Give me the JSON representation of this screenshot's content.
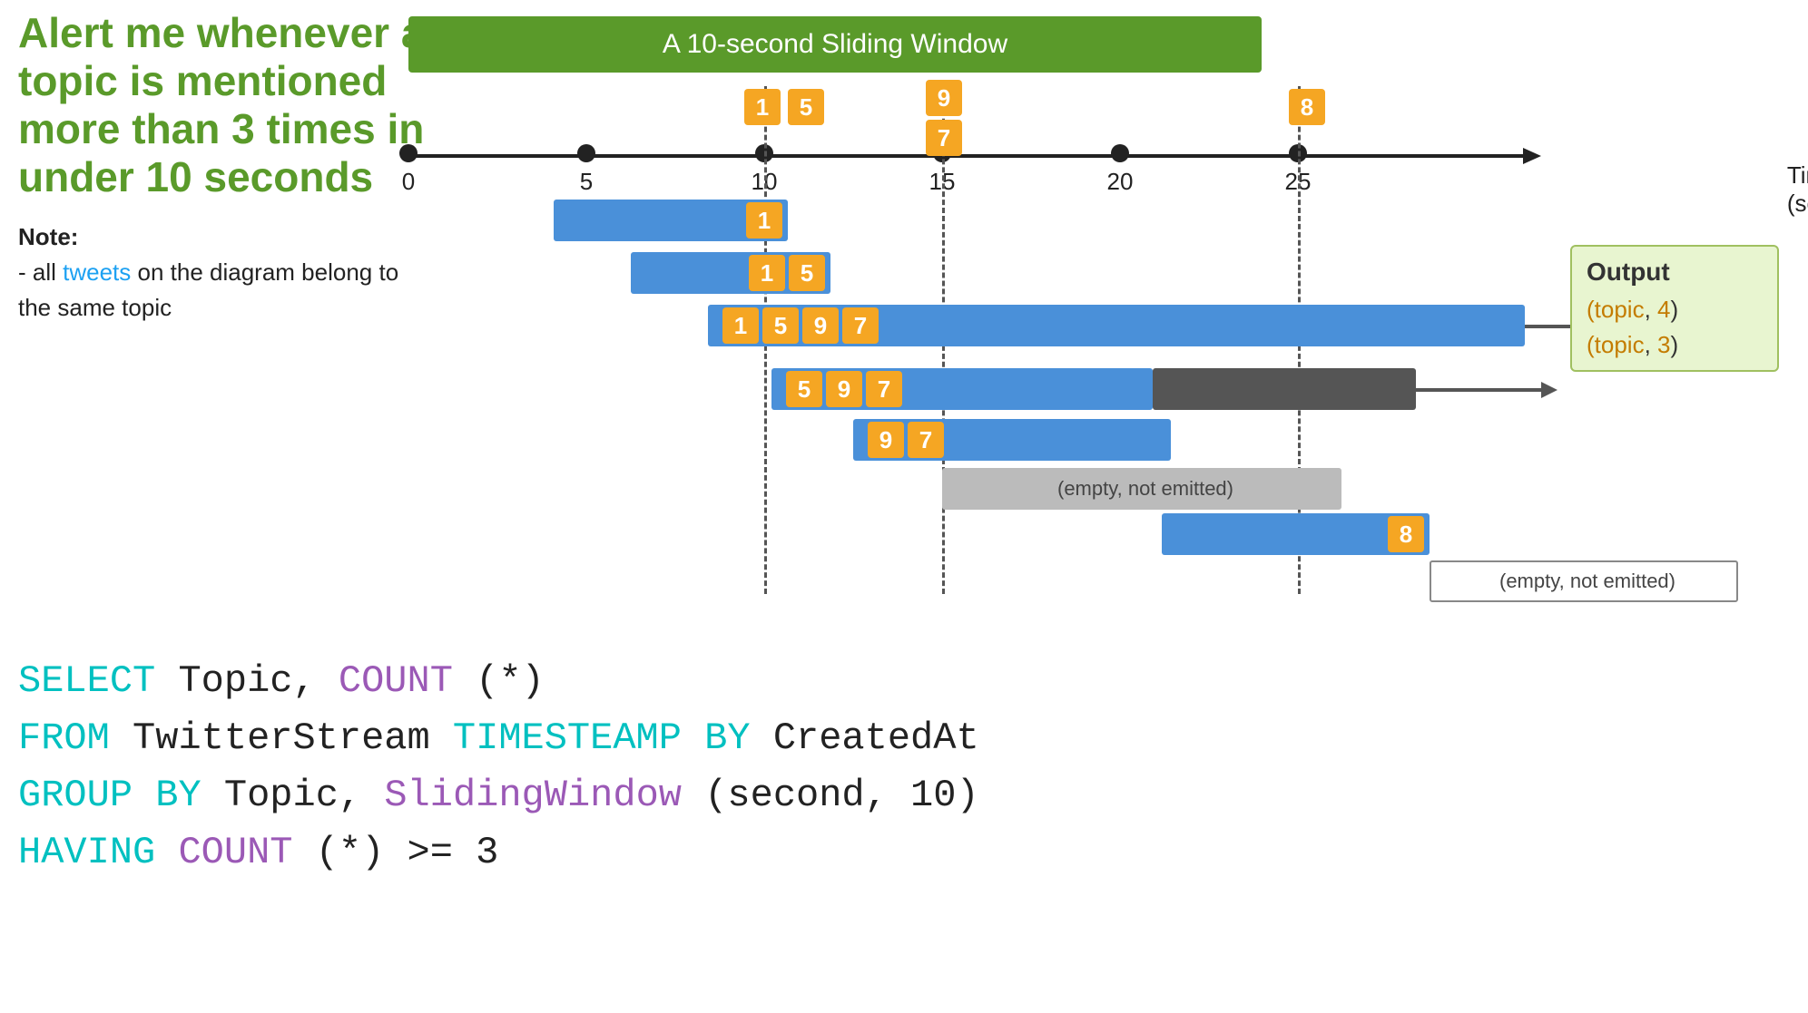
{
  "left": {
    "alert_line1": "Alert me whenever a",
    "alert_line2": "topic is mentioned",
    "alert_line3": "more than 3 times in",
    "alert_line4": "under 10 seconds",
    "note_label": "Note",
    "note_text1": "- all ",
    "note_tweets": "tweets",
    "note_text2": " on the diagram belong to the same topic"
  },
  "diagram": {
    "title": "A 10-second Sliding Window",
    "time_axis_label": "Time\n(second)",
    "time_ticks": [
      "0",
      "5",
      "10",
      "15",
      "20",
      "25"
    ],
    "badges_top": [
      {
        "value": "1",
        "pos_key": "t10"
      },
      {
        "value": "5",
        "pos_key": "t10b"
      },
      {
        "value": "9",
        "pos_key": "t15"
      },
      {
        "value": "7",
        "pos_key": "t15b"
      },
      {
        "value": "8",
        "pos_key": "t25"
      }
    ],
    "windows": [
      {
        "label": "1",
        "color": "blue"
      },
      {
        "label": "1 5",
        "color": "blue"
      },
      {
        "label": "1 5 9 7",
        "color": "blue"
      },
      {
        "label": "5 9 7",
        "color": "blue"
      },
      {
        "label": "9 7",
        "color": "blue"
      },
      {
        "label": "(empty, not emitted)",
        "color": "gray"
      },
      {
        "label": "8",
        "color": "blue"
      },
      {
        "label": "(empty, not emitted)",
        "color": "gray"
      }
    ],
    "output_label": "Output",
    "output_items": [
      {
        "text": "(topic, 4)"
      },
      {
        "text": "(topic, 3)"
      }
    ]
  },
  "sql": {
    "line1_kw1": "SELECT",
    "line1_rest": " Topic, ",
    "line1_kw2": "COUNT",
    "line1_rest2": "(*)",
    "line2_kw1": "FROM",
    "line2_rest": " TwitterStream ",
    "line2_kw2": "TIMESTEAMP",
    "line2_kw3": " BY",
    "line2_rest2": " CreatedAt",
    "line3_kw1": "GROUP",
    "line3_kw2": " BY",
    "line3_rest": " Topic, ",
    "line3_kw3": "SlidingWindow",
    "line3_rest2": "(second, 10)",
    "line4_kw1": "HAVING",
    "line4_rest": " ",
    "line4_kw2": "COUNT",
    "line4_rest2": "(*) >= 3"
  },
  "colors": {
    "green": "#5a9a2a",
    "blue_bar": "#4a90d9",
    "orange_badge": "#f5a623",
    "gray_bar": "#bbb",
    "dark_bar": "#555",
    "cyan": "#00c0c0",
    "purple": "#9b59b6",
    "output_bg": "#e8f5d0"
  }
}
